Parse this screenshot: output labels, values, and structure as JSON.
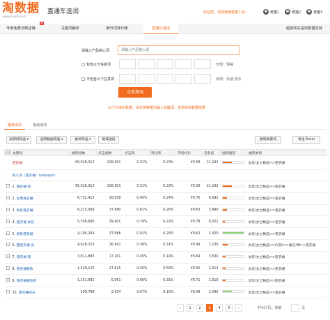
{
  "header": {
    "logo_text": "淘数据",
    "logo_url": "www.taosj.com",
    "app_title": "直通车选词",
    "welcome": "欢迎您，请您使用数据工具！",
    "accounts": [
      "老猫1",
      "老猫2",
      "老猫3"
    ]
  },
  "nav": {
    "items": [
      "专家免费诊断店铺",
      "关键词解析",
      "飙升词排行榜",
      "直通车选词",
      "超级快车提供数据支持"
    ],
    "hot_badge": "热"
  },
  "form": {
    "keyword_label": "请输入产品核心词",
    "keyword_placeholder": "请输入产品核心词",
    "include_label": "包含以下任意词",
    "include_example": "示例：短袖",
    "exclude_label": "不包含以下任意词",
    "exclude_example": "示例：长袖 男东",
    "submit": "点击淘词",
    "hint": "以下为演示数据，请在搜索框内输入关键词，查询实际数据结果"
  },
  "tabs": [
    "精准淘词",
    "无线淘词"
  ],
  "toolbar": {
    "keyword_filter": "关键词筛选",
    "all_data_filter": "全网数据筛选",
    "category_filter": "类目筛选",
    "region_view": "地域透视",
    "copy_keywords": "复制关键词",
    "export_excel": "导出 Excel"
  },
  "table": {
    "headers": [
      "",
      "关键词",
      "展现指数",
      "点击指数",
      "点击率",
      "转化率",
      "市场均价",
      "竞争度",
      "搜索趋势",
      "推荐类目"
    ],
    "summary": {
      "name": "连衣裙",
      "values": [
        "95,026,313",
        "326,901",
        "0.31%",
        "0.23%",
        "¥0.58",
        "21,192",
        "",
        "女装/女士精品>>连衣裙"
      ],
      "trend": 0.45,
      "trend_color": "#f26b1d"
    },
    "seed": {
      "name": "同义词（连衣裙：lianyiqun）"
    },
    "rows": [
      {
        "idx": "1.",
        "keyword": "连衣裙 的",
        "views": "95,026,313",
        "clicks": "326,901",
        "ctr": "0.31%",
        "cvr": "0.23%",
        "price": "¥0.58",
        "competition": "21,192",
        "trend": 0.45,
        "trend_color": "#f26b1d",
        "category": "女装/女士精品>>连衣裙"
      },
      {
        "idx": "2.",
        "keyword": "女用连衣裙",
        "views": "6,732,412",
        "clicks": "26,058",
        "ctr": "0.40%",
        "cvr": "0.24%",
        "price": "¥0.70",
        "competition": "6,092",
        "trend": 0.2,
        "trend_color": "#f26b1d",
        "category": "女装/女士精品>>连衣裙"
      },
      {
        "idx": "3.",
        "keyword": "女装连衣裙",
        "views": "6,215,069",
        "clicks": "37,680",
        "ctr": "0.61%",
        "cvr": "0.26%",
        "price": "¥0.63",
        "competition": "3,890",
        "trend": 0.2,
        "trend_color": "#f26b1d",
        "category": "女装/女士精品>>连衣裙"
      },
      {
        "idx": "4.",
        "keyword": "连衣裙 女装",
        "views": "5,358,666",
        "clicks": "39,401",
        "ctr": "0.74%",
        "cvr": "0.22%",
        "price": "¥0.78",
        "competition": "6,021",
        "trend": 0.12,
        "trend_color": "#f26b1d",
        "category": "女装/女士精品>>连衣裙"
      },
      {
        "idx": "5.",
        "keyword": "春装连衣裙",
        "views": "4,104,264",
        "clicks": "37,688",
        "ctr": "0.92%",
        "cvr": "0.24%",
        "price": "¥0.62",
        "competition": "2,420",
        "trend": 1.0,
        "trend_color": "#8fd17a",
        "category": "女装/女士精品>>连衣裙"
      },
      {
        "idx": "6.",
        "keyword": "蕾连衣裙 女",
        "views": "4,626,223",
        "clicks": "16,847",
        "ctr": "0.36%",
        "cvr": "0.31%",
        "price": "¥0.49",
        "competition": "7,130",
        "trend": 0.25,
        "trend_color": "#f26b1d",
        "category": "女装/女士精品>>(V领)>>裙子/棉>>连衣裙"
      },
      {
        "idx": "7.",
        "keyword": "连衣裙 夏",
        "views": "3,811,883",
        "clicks": "17,161",
        "ctr": "0.45%",
        "cvr": "0.19%",
        "price": "¥0.64",
        "competition": "3,530",
        "trend": 0.15,
        "trend_color": "#f26b1d",
        "category": "女装/女士精品>>连衣裙"
      },
      {
        "idx": "8.",
        "keyword": "连衣裙新款",
        "views": "1,529,123",
        "clicks": "27,615",
        "ctr": "0.45%",
        "cvr": "0.59%",
        "price": "¥0.56",
        "competition": "2,513",
        "trend": 0.15,
        "trend_color": "#f26b1d",
        "category": "女装/女士精品>>连衣裙"
      },
      {
        "idx": "9.",
        "keyword": "连衣裙春秋的",
        "views": "1,151,081",
        "clicks": "5,061",
        "ctr": "0.60%",
        "cvr": "0.31%",
        "price": "¥0.71",
        "competition": "2,019",
        "trend": 0.15,
        "trend_color": "#f26b1d",
        "category": "女装/女士精品>>连衣裙"
      },
      {
        "idx": "10.",
        "keyword": "连衣裙的长",
        "views": "300,768",
        "clicks": "2,034",
        "ctr": "0.67%",
        "cvr": "0.15%",
        "price": "¥0.49",
        "competition": "2,590",
        "trend": 0.45,
        "trend_color": "#8fd17a",
        "category": "女装/女士精品>>连衣裙"
      }
    ]
  },
  "pagination": {
    "prev": "‹",
    "pages": [
      "1",
      "2",
      "3",
      "4",
      "5"
    ],
    "active_page": "3",
    "next": "›",
    "info": "共427页，到第",
    "suffix": "页"
  },
  "colors": {
    "accent": "#f26b1d",
    "link": "#1a63b5"
  }
}
